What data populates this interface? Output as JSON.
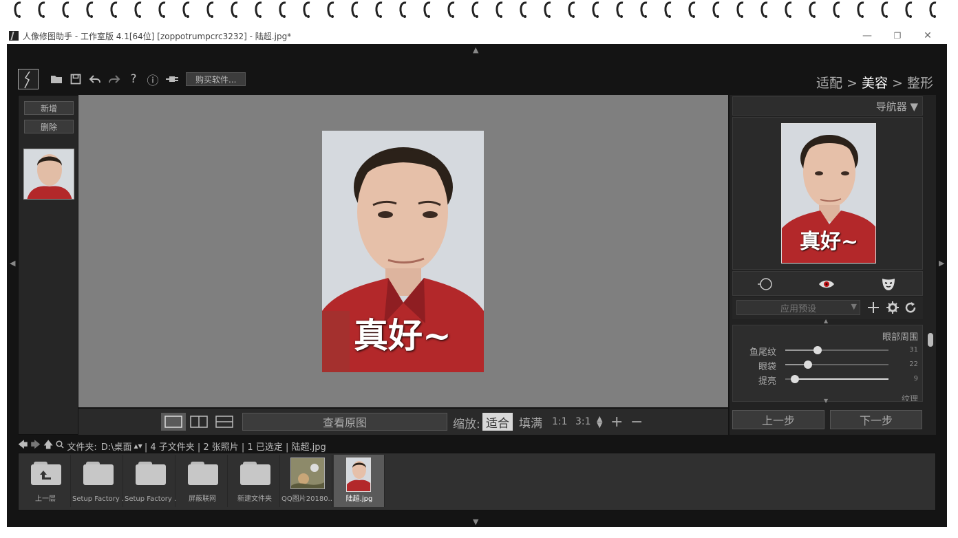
{
  "window": {
    "title": "人像修图助手 - 工作室版 4.1[64位] [zoppotrumpcrc3232] - 陆超.jpg*",
    "minimize_glyph": "—",
    "maximize_glyph": "❐",
    "close_glyph": "✕"
  },
  "toolbar": {
    "buy_label": "购买软件...",
    "icons": [
      "folder-icon",
      "save-icon",
      "undo-icon",
      "redo-icon",
      "help-icon",
      "info-icon",
      "plugin-icon"
    ],
    "help_glyph": "?",
    "info_glyph": "ⓘ"
  },
  "modes": {
    "fit": "适配",
    "beauty": "美容",
    "reshape": "整形",
    "separator": " > "
  },
  "left_panel": {
    "add_label": "新增",
    "delete_label": "删除"
  },
  "photo_text": "真好~",
  "canvas_bar": {
    "compare_label": "查看原图",
    "zoom_label": "缩放:",
    "zoom_fit": "适合",
    "zoom_fill": "填满",
    "zoom_1": "1:1",
    "zoom_3": "3:1",
    "plus": "+",
    "minus": "−"
  },
  "navigator": {
    "title": "导航器 ▼"
  },
  "preset": {
    "placeholder": "应用预设",
    "caret": "▼"
  },
  "adjust": {
    "section_title": "眼部周围",
    "next_section": "纹理",
    "sliders": [
      {
        "label": "鱼尾纹",
        "value": 31
      },
      {
        "label": "眼袋",
        "value": 22
      },
      {
        "label": "提亮",
        "value": 9
      }
    ]
  },
  "steps": {
    "prev": "上一步",
    "next": "下一步"
  },
  "pathbar": {
    "folder_label": "文件夹:",
    "folder_path": "D:\\桌面",
    "stats": "| 4 子文件夹 | 2 张照片 | 1 已选定 | 陆超.jpg"
  },
  "filmstrip": [
    {
      "label": "上一层",
      "kind": "up"
    },
    {
      "label": "Setup Factory ...",
      "kind": "folder"
    },
    {
      "label": "Setup Factory ...",
      "kind": "folder"
    },
    {
      "label": "屏蔽联网",
      "kind": "folder"
    },
    {
      "label": "新建文件夹",
      "kind": "folder"
    },
    {
      "label": "QQ图片20180...",
      "kind": "image"
    },
    {
      "label": "陆超.jpg",
      "kind": "image-selected"
    }
  ],
  "colors": {
    "app_bg": "#141414",
    "panel_bg": "#222222",
    "canvas_bg": "#7f7f7f",
    "shirt_red": "#b3282a"
  }
}
